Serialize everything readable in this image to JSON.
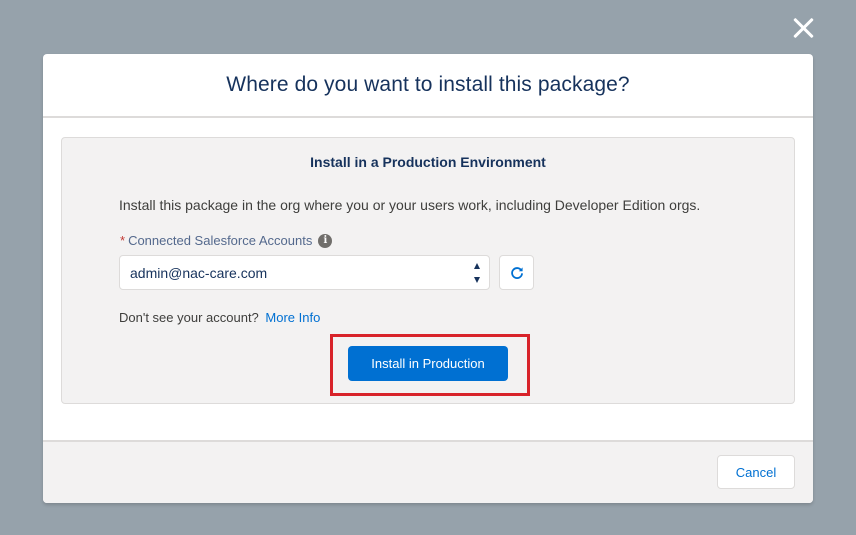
{
  "modal": {
    "title": "Where do you want to install this package?"
  },
  "card": {
    "title": "Install in a Production Environment",
    "description": "Install this package in the org where you or your users work, including Developer Edition orgs.",
    "field_label": "Connected Salesforce Accounts",
    "required_marker": "*",
    "info_glyph": "i",
    "selected_account": "admin@nac-care.com",
    "hint_text": "Don't see your account?",
    "hint_link": "More Info",
    "install_button": "Install in Production"
  },
  "footer": {
    "cancel_label": "Cancel"
  },
  "icons": {
    "close": "close-icon",
    "refresh": "refresh-icon",
    "info": "info-icon"
  },
  "colors": {
    "backdrop": "#96a2ab",
    "brand_blue": "#0070d2",
    "title_navy": "#16325c",
    "highlight_red": "#d8232a"
  }
}
